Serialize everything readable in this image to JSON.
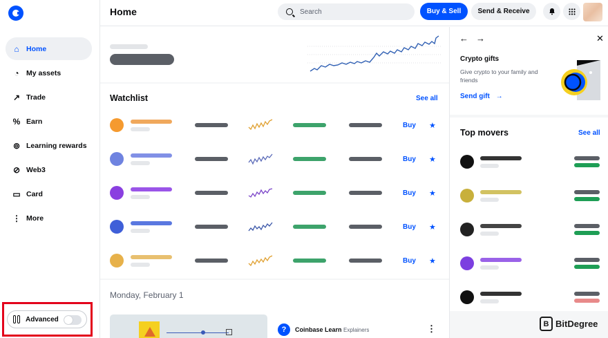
{
  "sidebar": {
    "items": [
      {
        "label": "Home",
        "icon": "home-icon",
        "glyph": "⌂"
      },
      {
        "label": "My assets",
        "icon": "pie-chart-icon",
        "glyph": "◔"
      },
      {
        "label": "Trade",
        "icon": "trend-icon",
        "glyph": "↗"
      },
      {
        "label": "Earn",
        "icon": "percent-icon",
        "glyph": "%"
      },
      {
        "label": "Learning rewards",
        "icon": "reward-icon",
        "glyph": "⊚"
      },
      {
        "label": "Web3",
        "icon": "web3-icon",
        "glyph": "⊘"
      },
      {
        "label": "Card",
        "icon": "card-icon",
        "glyph": "▭"
      },
      {
        "label": "More",
        "icon": "more-icon",
        "glyph": "⋮"
      }
    ],
    "advanced_label": "Advanced",
    "advanced_enabled": false
  },
  "header": {
    "title": "Home",
    "search_placeholder": "Search",
    "buy_sell": "Buy & Sell",
    "send_receive": "Send & Receive"
  },
  "watchlist": {
    "title": "Watchlist",
    "see_all": "See all",
    "buy_label": "Buy",
    "rows": [
      {
        "coin_color": "#f59a2f",
        "name_color": "#f0a85c",
        "spark_color": "#e0a030"
      },
      {
        "coin_color": "#6f83e0",
        "name_color": "#8190e6",
        "spark_color": "#5a6ab8"
      },
      {
        "coin_color": "#8a3fe0",
        "name_color": "#9a55e8",
        "spark_color": "#7b45c8"
      },
      {
        "coin_color": "#3f5fd8",
        "name_color": "#5a78e0",
        "spark_color": "#3a56a8"
      },
      {
        "coin_color": "#e7b14a",
        "name_color": "#e8c070",
        "spark_color": "#e0a030"
      }
    ]
  },
  "date_section": {
    "date": "Monday, February 1",
    "article_source": "Coinbase Learn",
    "article_tag": "Explainers"
  },
  "right_panel": {
    "gift_title": "Crypto gifts",
    "gift_desc": "Give crypto to your family and friends",
    "gift_link": "Send gift",
    "movers_title": "Top movers",
    "movers_see_all": "See all",
    "movers": [
      {
        "coin_color": "#111111",
        "name_color": "#333333"
      },
      {
        "coin_color": "#c8b03c",
        "name_color": "#d2c262"
      },
      {
        "coin_color": "#222222",
        "name_color": "#444444"
      },
      {
        "coin_color": "#7c3fe0",
        "name_color": "#9a62e8"
      },
      {
        "coin_color": "#111111",
        "name_color": "#333333"
      }
    ]
  },
  "watermark": "BitDegree",
  "colors": {
    "accent": "#0052ff",
    "highlight": "#e3001b"
  }
}
